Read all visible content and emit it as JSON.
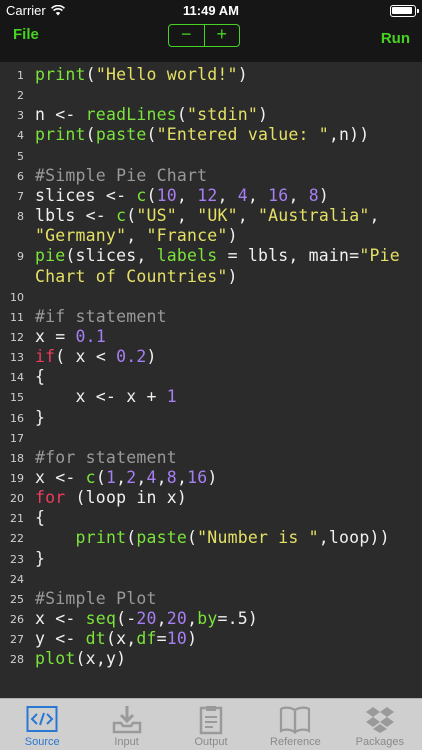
{
  "status_bar": {
    "carrier": "Carrier",
    "time": "11:49 AM"
  },
  "nav": {
    "file_label": "File",
    "run_label": "Run",
    "decrease_label": "−",
    "increase_label": "+"
  },
  "colors": {
    "accent": "#46d321",
    "editor_bg": "#2b2b2b",
    "function": "#7be33b",
    "string": "#e4e066",
    "number": "#a67ff2",
    "keyword": "#ec3c5a",
    "comment": "#999999"
  },
  "code_lines": [
    {
      "n": "1",
      "tokens": [
        [
          "fn",
          "print"
        ],
        [
          "plain",
          "("
        ],
        [
          "str",
          "\"Hello world!\""
        ],
        [
          "plain",
          ")"
        ]
      ]
    },
    {
      "n": "2",
      "tokens": []
    },
    {
      "n": "3",
      "tokens": [
        [
          "plain",
          "n <- "
        ],
        [
          "fn",
          "readLines"
        ],
        [
          "plain",
          "("
        ],
        [
          "str",
          "\"stdin\""
        ],
        [
          "plain",
          ")"
        ]
      ]
    },
    {
      "n": "4",
      "tokens": [
        [
          "fn",
          "print"
        ],
        [
          "plain",
          "("
        ],
        [
          "fn",
          "paste"
        ],
        [
          "plain",
          "("
        ],
        [
          "str",
          "\"Entered value: \""
        ],
        [
          "plain",
          ",n))"
        ]
      ]
    },
    {
      "n": "5",
      "tokens": []
    },
    {
      "n": "6",
      "tokens": [
        [
          "com",
          "#Simple Pie Chart"
        ]
      ]
    },
    {
      "n": "7",
      "tokens": [
        [
          "plain",
          "slices <- "
        ],
        [
          "fn",
          "c"
        ],
        [
          "plain",
          "("
        ],
        [
          "num",
          "10"
        ],
        [
          "plain",
          ", "
        ],
        [
          "num",
          "12"
        ],
        [
          "plain",
          ", "
        ],
        [
          "num",
          "4"
        ],
        [
          "plain",
          ", "
        ],
        [
          "num",
          "16"
        ],
        [
          "plain",
          ", "
        ],
        [
          "num",
          "8"
        ],
        [
          "plain",
          ")"
        ]
      ]
    },
    {
      "n": "8",
      "tokens": [
        [
          "plain",
          "lbls <- "
        ],
        [
          "fn",
          "c"
        ],
        [
          "plain",
          "("
        ],
        [
          "str",
          "\"US\""
        ],
        [
          "plain",
          ", "
        ],
        [
          "str",
          "\"UK\""
        ],
        [
          "plain",
          ", "
        ],
        [
          "str",
          "\"Australia\""
        ],
        [
          "plain",
          ","
        ]
      ]
    },
    {
      "n": "",
      "tokens": [
        [
          "str",
          "\"Germany\""
        ],
        [
          "plain",
          ", "
        ],
        [
          "str",
          "\"France\""
        ],
        [
          "plain",
          ")"
        ]
      ]
    },
    {
      "n": "9",
      "tokens": [
        [
          "fn",
          "pie"
        ],
        [
          "plain",
          "(slices, "
        ],
        [
          "fn",
          "labels"
        ],
        [
          "plain",
          " = lbls, main="
        ],
        [
          "str",
          "\"Pie"
        ]
      ]
    },
    {
      "n": "",
      "tokens": [
        [
          "str",
          "Chart of Countries\""
        ],
        [
          "plain",
          ")"
        ]
      ]
    },
    {
      "n": "10",
      "tokens": []
    },
    {
      "n": "11",
      "tokens": [
        [
          "com",
          "#if statement"
        ]
      ]
    },
    {
      "n": "12",
      "tokens": [
        [
          "plain",
          "x = "
        ],
        [
          "num",
          "0.1"
        ]
      ]
    },
    {
      "n": "13",
      "tokens": [
        [
          "kw",
          "if"
        ],
        [
          "plain",
          "( x < "
        ],
        [
          "num",
          "0.2"
        ],
        [
          "plain",
          ")"
        ]
      ]
    },
    {
      "n": "14",
      "tokens": [
        [
          "plain",
          "{"
        ]
      ]
    },
    {
      "n": "15",
      "tokens": [
        [
          "plain",
          "    x <- x + "
        ],
        [
          "num",
          "1"
        ]
      ]
    },
    {
      "n": "16",
      "tokens": [
        [
          "plain",
          "}"
        ]
      ]
    },
    {
      "n": "17",
      "tokens": []
    },
    {
      "n": "18",
      "tokens": [
        [
          "com",
          "#for statement"
        ]
      ]
    },
    {
      "n": "19",
      "tokens": [
        [
          "plain",
          "x <- "
        ],
        [
          "fn",
          "c"
        ],
        [
          "plain",
          "("
        ],
        [
          "num",
          "1"
        ],
        [
          "plain",
          ","
        ],
        [
          "num",
          "2"
        ],
        [
          "plain",
          ","
        ],
        [
          "num",
          "4"
        ],
        [
          "plain",
          ","
        ],
        [
          "num",
          "8"
        ],
        [
          "plain",
          ","
        ],
        [
          "num",
          "16"
        ],
        [
          "plain",
          ")"
        ]
      ]
    },
    {
      "n": "20",
      "tokens": [
        [
          "kw",
          "for"
        ],
        [
          "plain",
          " (loop in x)"
        ]
      ]
    },
    {
      "n": "21",
      "tokens": [
        [
          "plain",
          "{"
        ]
      ]
    },
    {
      "n": "22",
      "tokens": [
        [
          "plain",
          "    "
        ],
        [
          "fn",
          "print"
        ],
        [
          "plain",
          "("
        ],
        [
          "fn",
          "paste"
        ],
        [
          "plain",
          "("
        ],
        [
          "str",
          "\"Number is \""
        ],
        [
          "plain",
          ",loop))"
        ]
      ]
    },
    {
      "n": "23",
      "tokens": [
        [
          "plain",
          "}"
        ]
      ]
    },
    {
      "n": "24",
      "tokens": []
    },
    {
      "n": "25",
      "tokens": [
        [
          "com",
          "#Simple Plot"
        ]
      ]
    },
    {
      "n": "26",
      "tokens": [
        [
          "plain",
          "x <- "
        ],
        [
          "fn",
          "seq"
        ],
        [
          "plain",
          "(-"
        ],
        [
          "num",
          "20"
        ],
        [
          "plain",
          ","
        ],
        [
          "num",
          "20"
        ],
        [
          "plain",
          ","
        ],
        [
          "fn",
          "by"
        ],
        [
          "plain",
          "=.5)"
        ]
      ]
    },
    {
      "n": "27",
      "tokens": [
        [
          "plain",
          "y <- "
        ],
        [
          "fn",
          "dt"
        ],
        [
          "plain",
          "(x,"
        ],
        [
          "fn",
          "df"
        ],
        [
          "plain",
          "="
        ],
        [
          "num",
          "10"
        ],
        [
          "plain",
          ")"
        ]
      ]
    },
    {
      "n": "28",
      "tokens": [
        [
          "fn",
          "plot"
        ],
        [
          "plain",
          "(x,y)"
        ]
      ]
    }
  ],
  "tabs": [
    {
      "label": "Source",
      "icon": "code-icon",
      "active": true
    },
    {
      "label": "Input",
      "icon": "input-tray-icon",
      "active": false
    },
    {
      "label": "Output",
      "icon": "clipboard-output-icon",
      "active": false
    },
    {
      "label": "Reference",
      "icon": "book-icon",
      "active": false
    },
    {
      "label": "Packages",
      "icon": "dropbox-packages-icon",
      "active": false
    }
  ]
}
